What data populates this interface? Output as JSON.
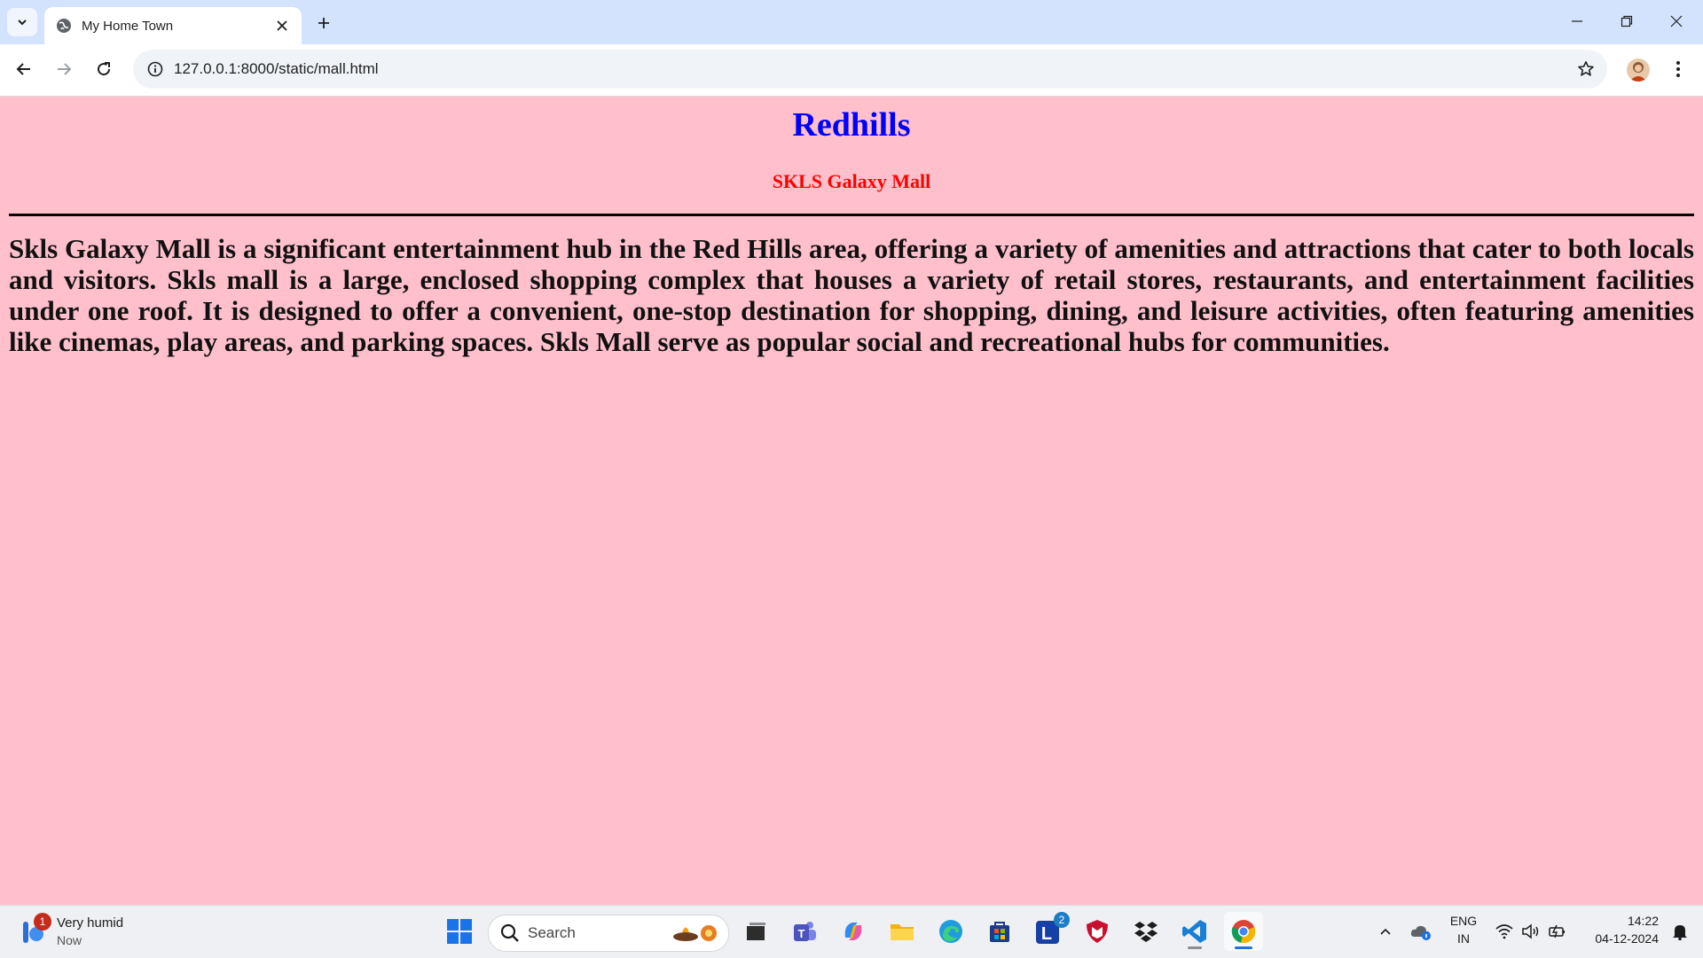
{
  "browser": {
    "tab_title": "My Home Town",
    "url": "127.0.0.1:8000/static/mall.html"
  },
  "page": {
    "heading": "Redhills",
    "subheading": "SKLS Galaxy Mall",
    "paragraph": "Skls Galaxy Mall is a significant entertainment hub in the Red Hills area, offering a variety of amenities and attractions that cater to both locals and visitors. Skls mall is a large, enclosed shopping complex that houses a variety of retail stores, restaurants, and entertainment facilities under one roof. It is designed to offer a convenient, one-stop destination for shopping, dining, and leisure activities, often featuring amenities like cinemas, play areas, and parking spaces. Skls Mall serve as popular social and recreational hubs for communities.",
    "colors": {
      "background": "#ffc0cb",
      "heading": "#0000ff",
      "subheading": "#ff0000"
    }
  },
  "taskbar": {
    "weather_badge": "1",
    "weather_title": "Very humid",
    "weather_sub": "Now",
    "search_placeholder": "Search",
    "lexicon_badge": "2",
    "lang_top": "ENG",
    "lang_bottom": "IN",
    "time": "14:22",
    "date": "04-12-2024"
  }
}
